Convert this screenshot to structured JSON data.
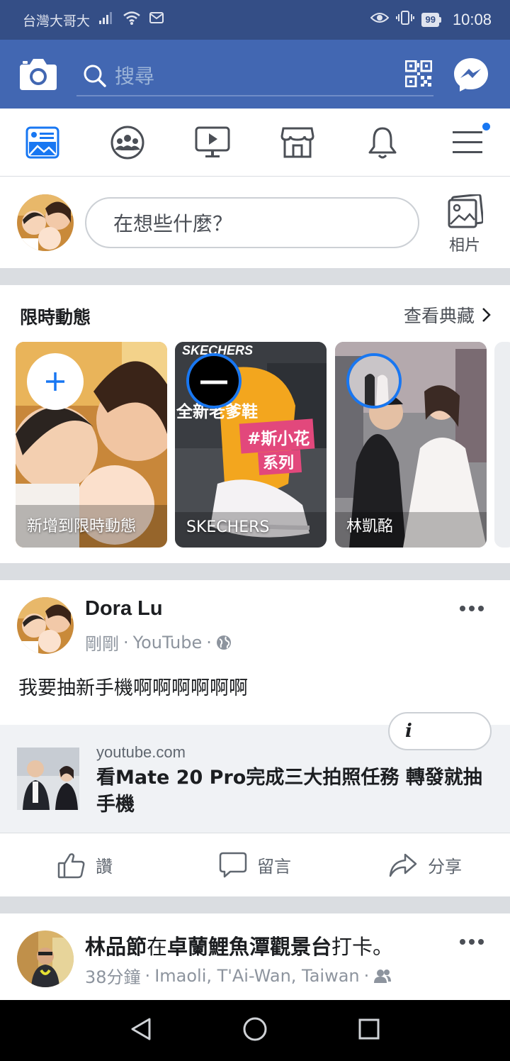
{
  "status_bar": {
    "carrier": "台灣大哥大",
    "battery": "99",
    "time": "10:08"
  },
  "header": {
    "search_placeholder": "搜尋",
    "icons": [
      "camera-icon",
      "search-icon",
      "qr-code-icon",
      "messenger-icon"
    ]
  },
  "nav_tabs": [
    {
      "name": "news-feed",
      "icon": "news-feed-icon",
      "active": true
    },
    {
      "name": "groups",
      "icon": "groups-icon"
    },
    {
      "name": "watch",
      "icon": "watch-icon"
    },
    {
      "name": "marketplace",
      "icon": "marketplace-icon"
    },
    {
      "name": "notifications",
      "icon": "bell-icon"
    },
    {
      "name": "menu",
      "icon": "menu-icon",
      "badge": true
    }
  ],
  "composer": {
    "placeholder": "在想些什麼？",
    "photo_label": "相片"
  },
  "stories": {
    "title": "限時動態",
    "archive_label": "查看典藏",
    "items": [
      {
        "label": "新增到限時動態"
      },
      {
        "label": "SKECHERS",
        "banner": "SKECHERS",
        "line1": "全新老爹鞋",
        "line2": "#斯小花",
        "line3": "系列"
      },
      {
        "label": "林凱酩"
      }
    ]
  },
  "post": {
    "author": "Dora Lu",
    "time": "剛剛",
    "source": "YouTube",
    "text": "我要抽新手機啊啊啊啊啊啊",
    "link": {
      "domain": "youtube.com",
      "title": "看Mate 20 Pro完成三大拍照任務 轉發就抽手機"
    },
    "info_label": "i",
    "actions": {
      "like": "讚",
      "comment": "留言",
      "share": "分享"
    }
  },
  "post2": {
    "author": "林品節",
    "in_word": "在",
    "place": "卓蘭鯉魚潭觀景台",
    "suffix": "打卡。",
    "time": "38分鐘",
    "location": "Imaoli, T'Ai-Wan, Taiwan"
  },
  "colors": {
    "header_blue": "#4267b2",
    "status_blue": "#344e86",
    "accent": "#1877f2",
    "divider": "#dadde1"
  }
}
